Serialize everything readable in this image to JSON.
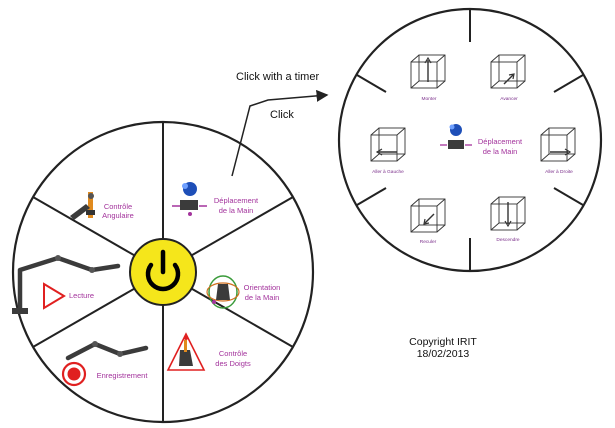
{
  "annotations": {
    "click_with_timer": "Click with a timer",
    "click": "Click"
  },
  "main_wheel": {
    "center_icon": "power-icon",
    "center_color": "#f5e61b",
    "segments": [
      {
        "id": "controle-angulaire",
        "label_lines": [
          "Contrôle",
          "Angulaire"
        ],
        "icon": "robot-arm-joint-icon"
      },
      {
        "id": "deplacement-main",
        "label_lines": [
          "Déplacement",
          "de la Main"
        ],
        "icon": "hand-move-icon"
      },
      {
        "id": "orientation-main",
        "label_lines": [
          "Orientation",
          "de la Main"
        ],
        "icon": "hand-rotate-icon"
      },
      {
        "id": "controle-doigts",
        "label_lines": [
          "Contrôle",
          "des Doigts"
        ],
        "icon": "finger-control-icon"
      },
      {
        "id": "enregistrement",
        "label_lines": [
          "Enregistrement"
        ],
        "icon": "record-icon"
      },
      {
        "id": "lecture",
        "label_lines": [
          "Lecture"
        ],
        "icon": "play-icon"
      }
    ]
  },
  "sub_wheel": {
    "center_label_lines": [
      "Déplacement",
      "de la Main"
    ],
    "center_icon": "hand-move-icon",
    "segments": [
      {
        "id": "monter",
        "label": "Monter",
        "icon": "cube-arrow-up-icon"
      },
      {
        "id": "avancer",
        "label": "Avancer",
        "icon": "cube-arrow-forward-icon"
      },
      {
        "id": "aller-droite",
        "label": "Aller à Droite",
        "icon": "cube-arrow-right-icon"
      },
      {
        "id": "descendre",
        "label": "Descendre",
        "icon": "cube-arrow-down-icon"
      },
      {
        "id": "reculer",
        "label": "Reculer",
        "icon": "cube-arrow-back-icon"
      },
      {
        "id": "aller-gauche",
        "label": "Aller à Gauche",
        "icon": "cube-arrow-left-icon"
      }
    ]
  },
  "copyright": {
    "line1": "Copyright IRIT",
    "line2": "18/02/2013"
  },
  "colors": {
    "accent_purple": "#a3339c",
    "record_red": "#e02020",
    "play_red": "#e02020",
    "line": "#222222"
  }
}
